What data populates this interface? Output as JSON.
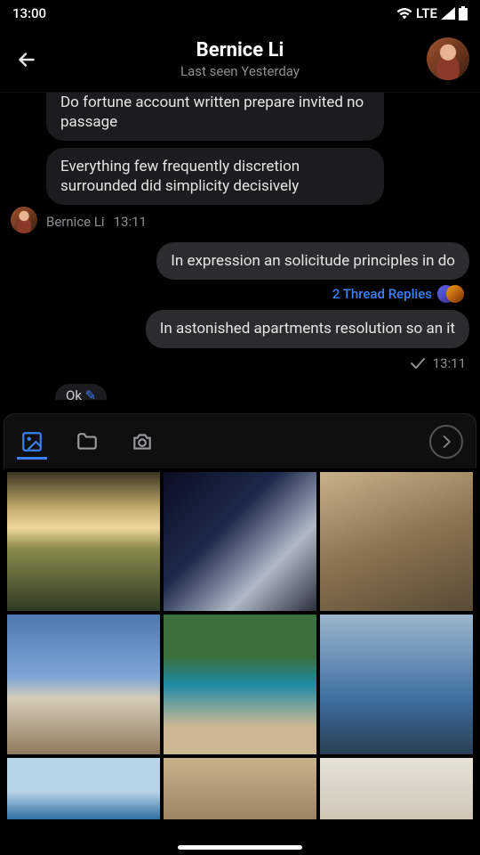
{
  "status": {
    "time": "13:00",
    "network": "LTE"
  },
  "header": {
    "name": "Bernice Li",
    "status": "Last seen Yesterday"
  },
  "messages": {
    "in1": "Do fortune account written prepare invited no passage",
    "in2": "Everything few frequently discretion surrounded did simplicity decisively",
    "sender": "Bernice Li",
    "sender_time": "13:11",
    "out1": "In expression an solicitude principles in do",
    "thread": "2 Thread Replies",
    "out2": "In astonished apartments resolution so an it",
    "sent_time": "13:11",
    "typing_peek": "Ok"
  },
  "attach": {
    "tabs": [
      "gallery",
      "files",
      "camera"
    ],
    "active_tab": "gallery"
  }
}
